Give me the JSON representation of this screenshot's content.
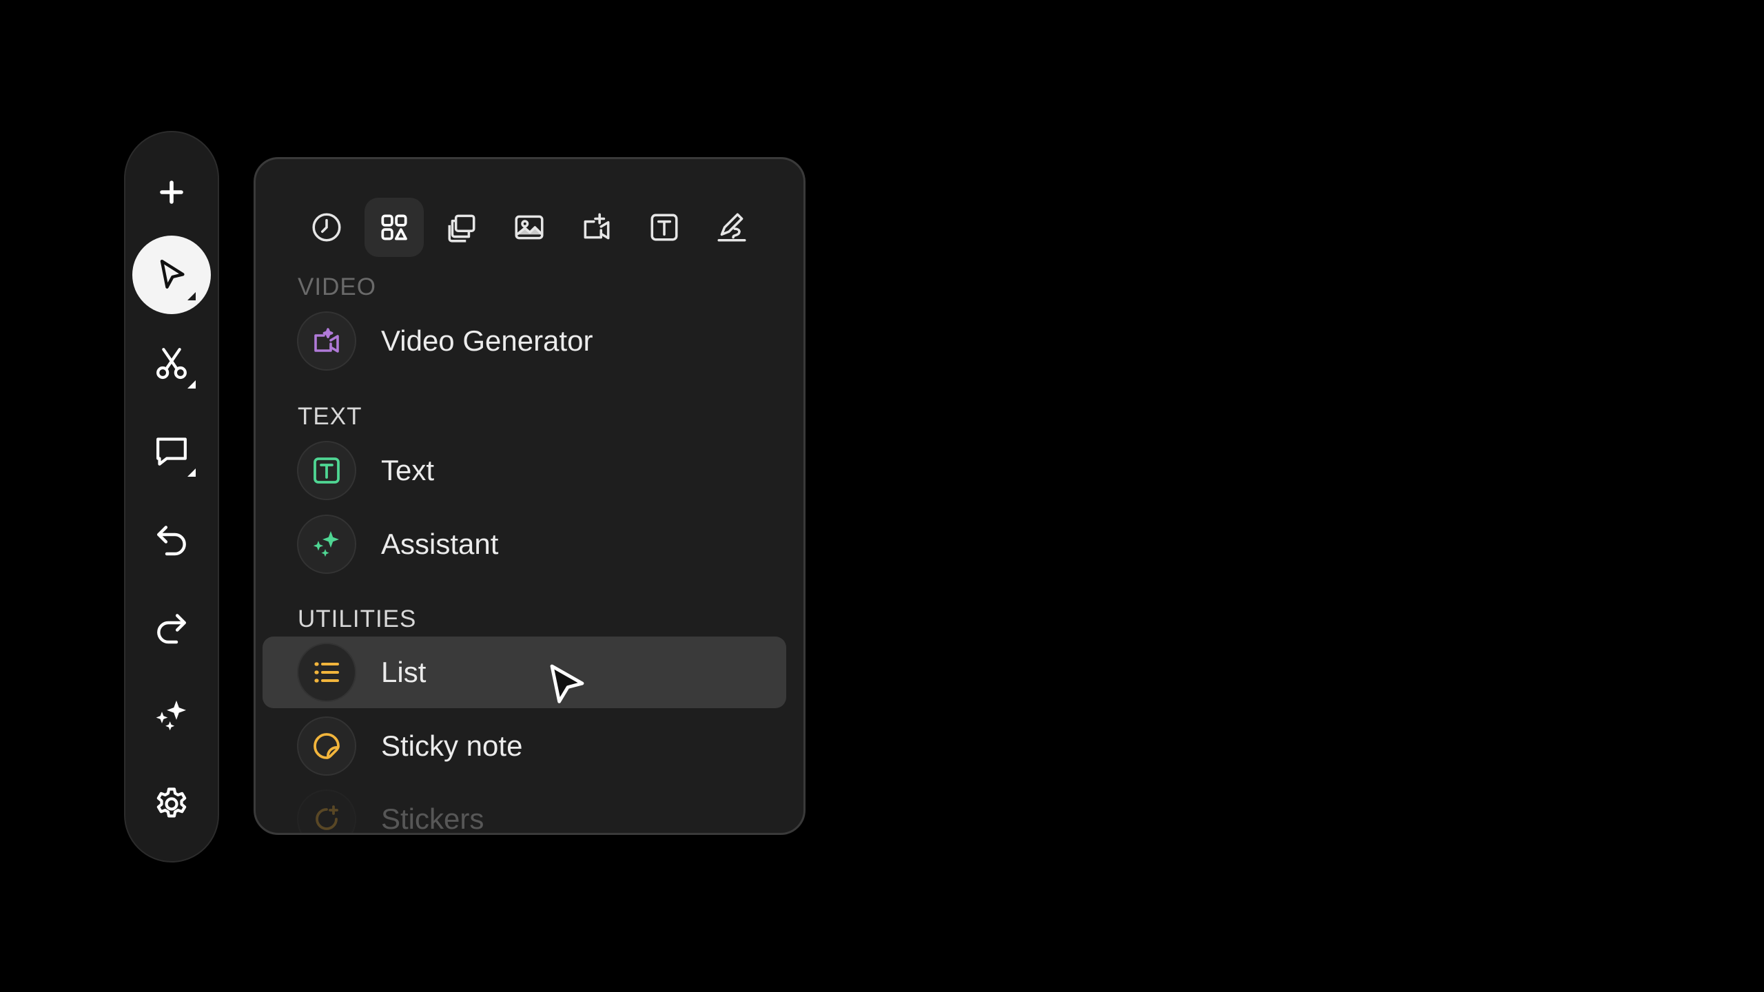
{
  "toolbar": {
    "tools": [
      {
        "icon": "plus-icon",
        "active": false
      },
      {
        "icon": "pointer-icon",
        "active": true,
        "has_submenu": true
      },
      {
        "icon": "scissors-icon",
        "active": false,
        "has_submenu": true
      },
      {
        "icon": "comment-icon",
        "active": false,
        "has_submenu": true
      },
      {
        "icon": "undo-icon",
        "active": false
      },
      {
        "icon": "redo-icon",
        "active": false
      },
      {
        "icon": "sparkles-icon",
        "active": false
      },
      {
        "icon": "gear-icon",
        "active": false
      }
    ]
  },
  "panel": {
    "tabs": [
      {
        "icon": "clock-icon",
        "active": false
      },
      {
        "icon": "grid-icon",
        "active": true
      },
      {
        "icon": "layers-icon",
        "active": false
      },
      {
        "icon": "image-icon",
        "active": false
      },
      {
        "icon": "video-plus-icon",
        "active": false
      },
      {
        "icon": "text-box-icon",
        "active": false
      },
      {
        "icon": "draw-icon",
        "active": false
      }
    ],
    "sections": {
      "video": {
        "label": "VIDEO",
        "items": [
          {
            "label": "Video Generator",
            "icon": "video-generator-icon",
            "color": "#b07ad8"
          }
        ]
      },
      "text": {
        "label": "TEXT",
        "items": [
          {
            "label": "Text",
            "icon": "text-icon",
            "color": "#4fd693"
          },
          {
            "label": "Assistant",
            "icon": "sparkles-icon",
            "color": "#4fd693"
          }
        ]
      },
      "utilities": {
        "label": "UTILITIES",
        "items": [
          {
            "label": "List",
            "icon": "list-icon",
            "color": "#f2b53c",
            "hovered": true
          },
          {
            "label": "Sticky note",
            "icon": "sticky-note-icon",
            "color": "#f2b53c"
          },
          {
            "label": "Stickers",
            "icon": "stickers-icon",
            "color": "#f2b53c"
          }
        ]
      }
    }
  },
  "colors": {
    "background": "#000000",
    "surface": "#1e1e1e",
    "accent_purple": "#b07ad8",
    "accent_green": "#4fd693",
    "accent_yellow": "#f2b53c"
  }
}
